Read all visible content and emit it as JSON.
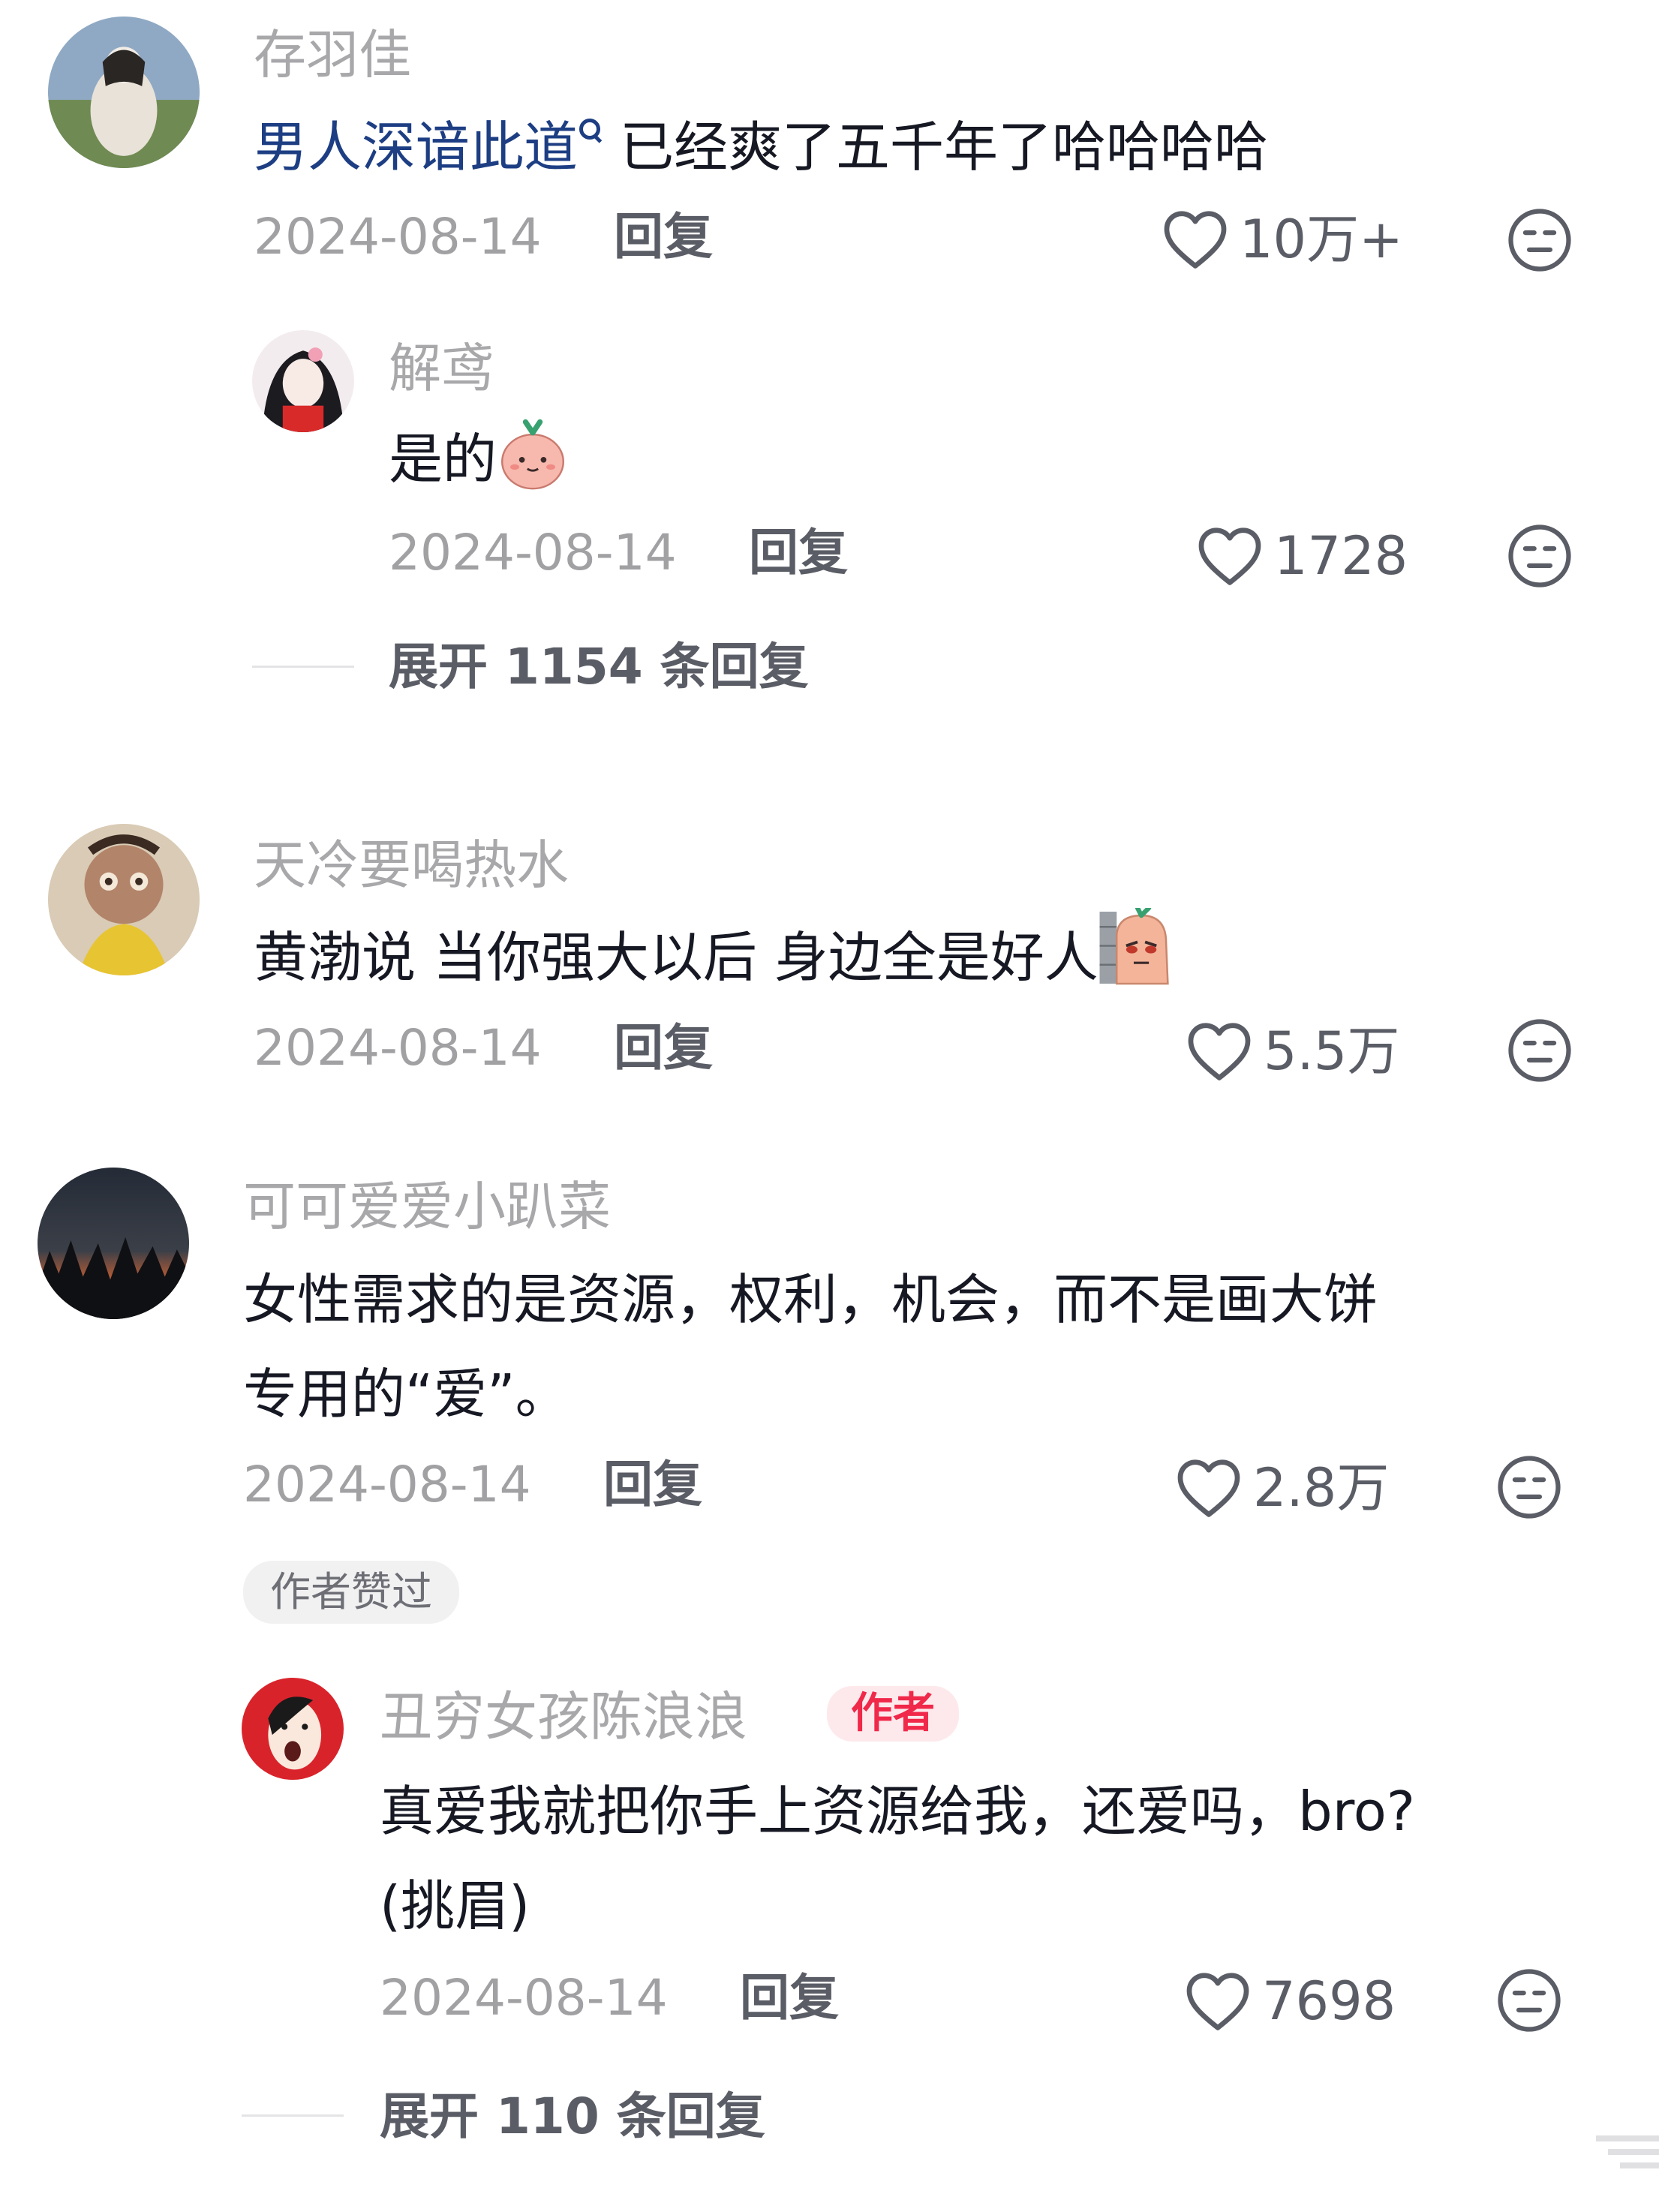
{
  "comments": [
    {
      "name": "存羽佳",
      "link_text": "男人深谙此道",
      "text_after_link": "已经爽了五千年了哈哈哈哈",
      "date": "2024-08-14",
      "reply_label": "回复",
      "likes": "10万+",
      "replies": [
        {
          "name": "解鸢",
          "text": "是的",
          "date": "2024-08-14",
          "reply_label": "回复",
          "likes": "1728"
        }
      ],
      "expand_label": "展开 1154 条回复"
    },
    {
      "name": "天冷要喝热水",
      "text": "黄渤说 当你强大以后 身边全是好人",
      "date": "2024-08-14",
      "reply_label": "回复",
      "likes": "5.5万"
    },
    {
      "name": "可可爱爱小趴菜",
      "text_line1": "女性需求的是资源，权利，机会，而不是画大饼",
      "text_line2": "专用的“爱”。",
      "date": "2024-08-14",
      "reply_label": "回复",
      "likes": "2.8万",
      "author_liked_badge": "作者赞过",
      "replies": [
        {
          "name": "丑穷女孩陈浪浪",
          "author_badge": "作者",
          "text_line1": "真爱我就把你手上资源给我，还爱吗，bro?",
          "text_line2": "(挑眉)",
          "date": "2024-08-14",
          "reply_label": "回复",
          "likes": "7698"
        }
      ],
      "expand_label": "展开 110 条回复"
    }
  ],
  "icons": {
    "like": "heart-outline-icon",
    "reaction": "meh-face-icon",
    "search": "search-icon"
  },
  "colors": {
    "link": "#1d3e83",
    "author_badge_text": "#f02849",
    "author_badge_bg": "#fde9ec",
    "muted": "#a8a8ab"
  }
}
